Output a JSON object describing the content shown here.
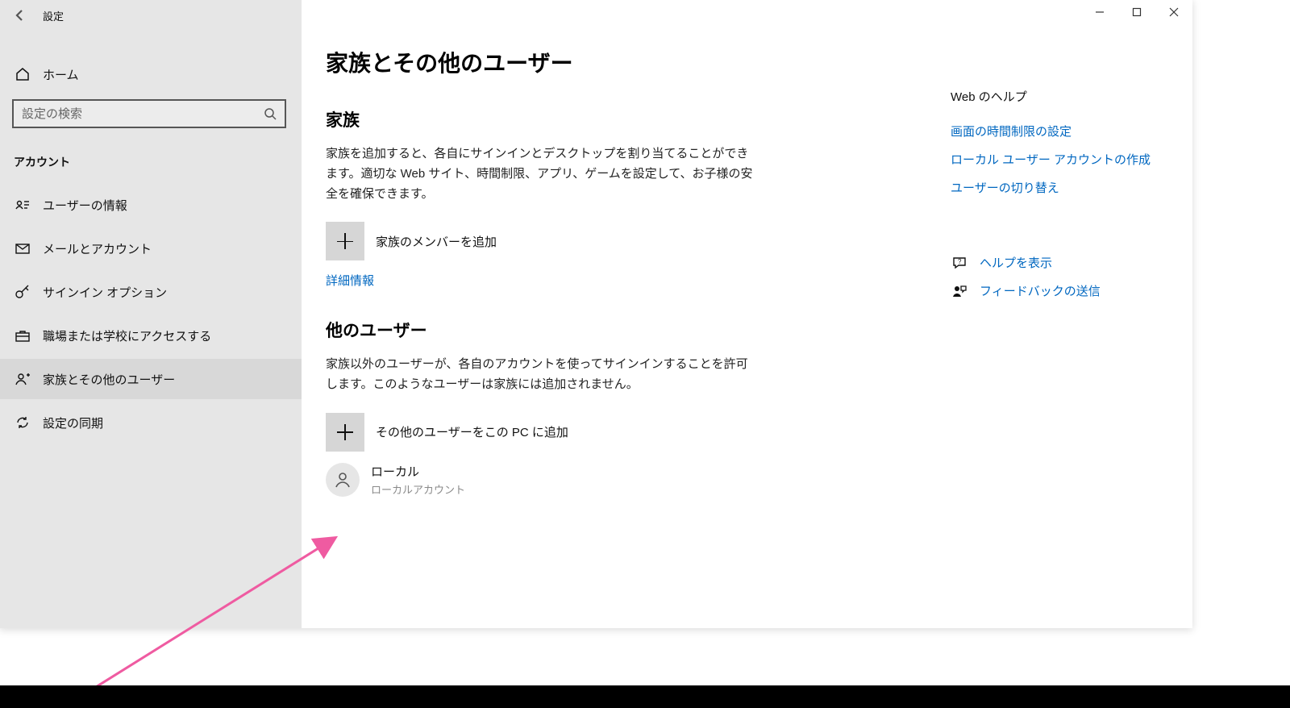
{
  "window": {
    "app_title": "設定",
    "minimize": "最小化",
    "maximize": "最大化",
    "close": "閉じる"
  },
  "sidebar": {
    "home_label": "ホーム",
    "search_placeholder": "設定の検索",
    "section_label": "アカウント",
    "items": [
      {
        "label": "ユーザーの情報"
      },
      {
        "label": "メールとアカウント"
      },
      {
        "label": "サインイン オプション"
      },
      {
        "label": "職場または学校にアクセスする"
      },
      {
        "label": "家族とその他のユーザー"
      },
      {
        "label": "設定の同期"
      }
    ]
  },
  "main": {
    "page_title": "家族とその他のユーザー",
    "family": {
      "heading": "家族",
      "description": "家族を追加すると、各自にサインインとデスクトップを割り当てることができます。適切な Web サイト、時間制限、アプリ、ゲームを設定して、お子様の安全を確保できます。",
      "add_label": "家族のメンバーを追加",
      "details_link": "詳細情報"
    },
    "others": {
      "heading": "他のユーザー",
      "description": "家族以外のユーザーが、各自のアカウントを使ってサインインすることを許可します。このようなユーザーは家族には追加されません。",
      "add_label": "その他のユーザーをこの PC に追加",
      "user": {
        "name": "ローカル",
        "type": "ローカルアカウント"
      }
    }
  },
  "help": {
    "heading": "Web のヘルプ",
    "links": [
      "画面の時間制限の設定",
      "ローカル ユーザー アカウントの作成",
      "ユーザーの切り替え"
    ],
    "get_help": "ヘルプを表示",
    "feedback": "フィードバックの送信"
  }
}
